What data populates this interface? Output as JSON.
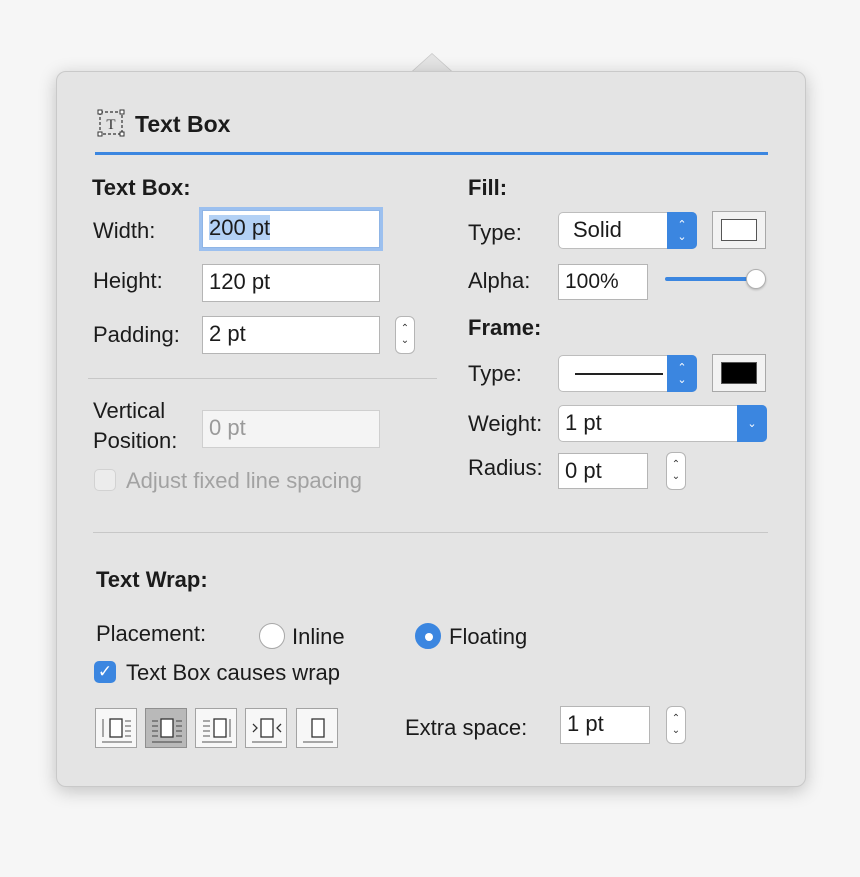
{
  "header": {
    "title": "Text Box",
    "icon": "text-box-icon",
    "accent_color": "#3b86e0"
  },
  "text_box": {
    "section_label": "Text Box:",
    "width_label": "Width:",
    "width_value": "200 pt",
    "height_label": "Height:",
    "height_value": "120 pt",
    "padding_label": "Padding:",
    "padding_value": "2 pt",
    "vertical_label_line1": "Vertical",
    "vertical_label_line2": "Position:",
    "vertical_placeholder": "0 pt",
    "adjust_spacing_label": "Adjust fixed line spacing",
    "adjust_spacing_checked": false
  },
  "fill": {
    "section_label": "Fill:",
    "type_label": "Type:",
    "type_value": "Solid",
    "alpha_label": "Alpha:",
    "alpha_value": "100%",
    "alpha_level": 1.0,
    "swatch_color": "#ffffff"
  },
  "frame": {
    "section_label": "Frame:",
    "type_label": "Type:",
    "weight_label": "Weight:",
    "weight_value": "1 pt",
    "radius_label": "Radius:",
    "radius_value": "0 pt",
    "swatch_color": "#000000"
  },
  "text_wrap": {
    "section_label": "Text Wrap:",
    "placement_label": "Placement:",
    "inline_label": "Inline",
    "inline_selected": false,
    "floating_label": "Floating",
    "floating_selected": true,
    "causes_wrap_label": "Text Box causes wrap",
    "causes_wrap_checked": true,
    "extra_space_label": "Extra space:",
    "extra_space_value": "1 pt",
    "wrap_buttons": [
      "wrap-left-icon",
      "wrap-both-sides-icon",
      "wrap-right-icon",
      "wrap-largest-side-icon",
      "wrap-none-icon"
    ],
    "selected_wrap_index": 1
  }
}
